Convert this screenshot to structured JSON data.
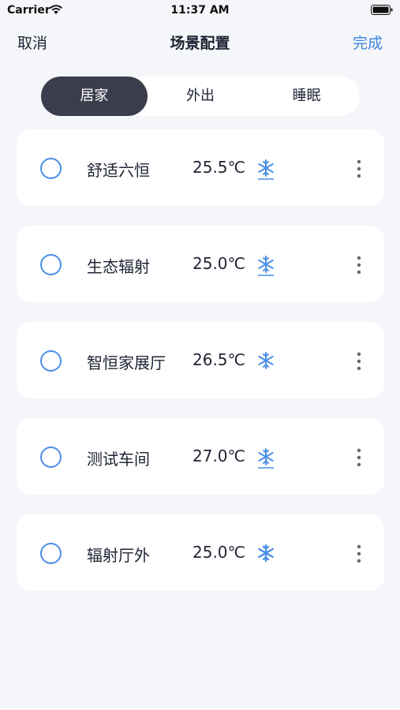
{
  "status_bar": {
    "carrier": "Carrier",
    "time": "11:37 AM",
    "icons": [
      "wifi-icon",
      "battery-icon"
    ]
  },
  "nav": {
    "left_label": "取消",
    "title": "场景配置",
    "right_label": "完成",
    "right_color": "#3d86dc"
  },
  "tabs": [
    {
      "label": "居家",
      "active": true
    },
    {
      "label": "外出",
      "active": false
    },
    {
      "label": "睡眠",
      "active": false
    }
  ],
  "scenes": [
    {
      "name": "舒适六恒",
      "temperature": "25.5℃",
      "mode_icon": "snowflake-icon"
    },
    {
      "name": "生态辐射",
      "temperature": "25.0℃",
      "mode_icon": "snowflake-icon"
    },
    {
      "name": "智恒家展厅",
      "temperature": "26.5℃",
      "mode_icon": "snowflake-icon"
    },
    {
      "name": "测试车间",
      "temperature": "27.0℃",
      "mode_icon": "snowflake-icon"
    },
    {
      "name": "辐射厅外",
      "temperature": "25.0℃",
      "mode_icon": "snowflake-icon"
    }
  ],
  "colors": {
    "accent": "#4a8ee6",
    "active_tab_bg": "#3b3d4c",
    "background": "#f4f6f9",
    "card_bg": "#ffffff"
  }
}
